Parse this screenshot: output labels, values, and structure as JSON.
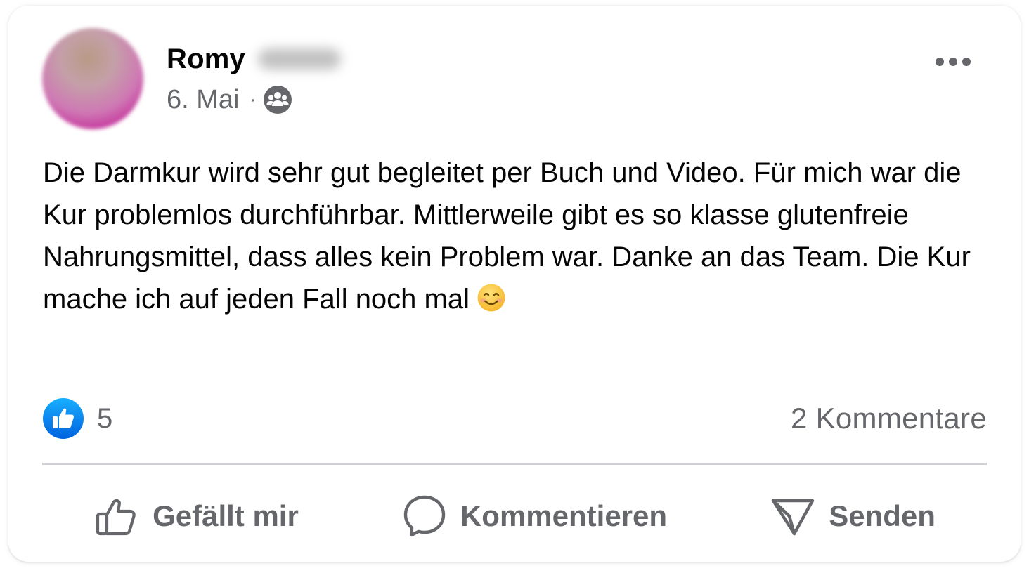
{
  "post": {
    "author_first_name": "Romy",
    "date": "6. Mai",
    "separator": "·",
    "privacy_icon": "group-icon",
    "more_icon": "more-options-icon",
    "text": "Die Darmkur wird sehr gut begleitet per Buch und Video. Für mich war die Kur problemlos durchführbar. Mittlerweile gibt es so klasse glutenfreie Nahrungsmittel, dass alles kein Problem war. Danke an das Team. Die Kur mache ich auf jeden Fall noch mal",
    "emoji_icon": "smiling-face-emoji"
  },
  "stats": {
    "like_count": "5",
    "like_icon": "thumbs-up-badge-icon",
    "comments": "2 Kommentare"
  },
  "actions": {
    "like_label": "Gefällt mir",
    "comment_label": "Kommentieren",
    "send_label": "Senden"
  },
  "colors": {
    "like_blue": "#1877f2",
    "secondary_text": "#65676b",
    "primary_text": "#050505",
    "divider": "#ced0d4",
    "emoji_yellow": "#ffcc4d"
  }
}
